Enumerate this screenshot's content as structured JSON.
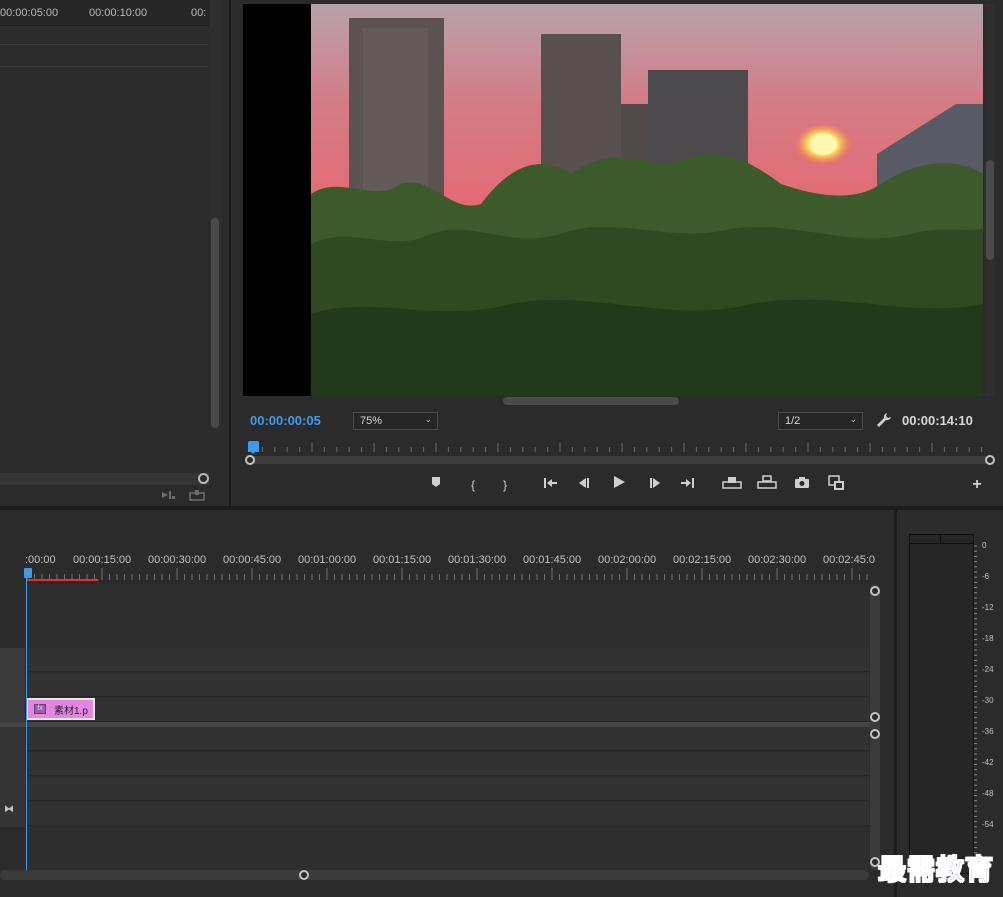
{
  "source_monitor": {
    "ruler_labels": [
      "00:00:05:00",
      "00:00:10:00",
      "00:"
    ]
  },
  "program_monitor": {
    "playhead_timecode": "00:00:00:05",
    "zoom_level": "75%",
    "resolution": "1/2",
    "duration_timecode": "00:00:14:10",
    "transport_icons": [
      "add-marker-icon",
      "mark-in-icon",
      "mark-out-icon",
      "go-to-in-icon",
      "step-back-icon",
      "play-icon",
      "step-forward-icon",
      "go-to-out-icon",
      "lift-icon",
      "extract-icon",
      "export-frame-icon",
      "comparison-view-icon",
      "add-button-icon"
    ],
    "glyphs": {
      "marker": "⬟",
      "mark_in": "{",
      "mark_out": "}",
      "go_in": "{←",
      "step_back": "◀|",
      "play": "▶",
      "step_fwd": "|▶",
      "go_out": "→}",
      "lift": "⊓",
      "extract": "⊔",
      "camera": "📷",
      "compare": "▣",
      "plus": "+",
      "wrench": "🔧",
      "chevron": "⌄"
    }
  },
  "timeline": {
    "ruler_labels": [
      ":00:00",
      "00:00:15:00",
      "00:00:30:00",
      "00:00:45:00",
      "00:01:00:00",
      "00:01:15:00",
      "00:01:30:00",
      "00:01:45:00",
      "00:02:00:00",
      "00:02:15:00",
      "00:02:30:00",
      "00:02:45:0"
    ],
    "clip": {
      "label": "素材1.p",
      "fx_badge": "fx"
    },
    "bowtie_glyph": "⧓"
  },
  "audio_meter": {
    "db_labels": [
      "0",
      "-6",
      "-12",
      "-18",
      "-24",
      "-30",
      "-36",
      "-42",
      "-48",
      "-54"
    ]
  },
  "watermark": "最需教育",
  "colors": {
    "accent_blue": "#3f9bea",
    "work_area_red": "#e0342c",
    "clip_pink": "#e286e0",
    "panel_bg": "#2b2b2b"
  }
}
